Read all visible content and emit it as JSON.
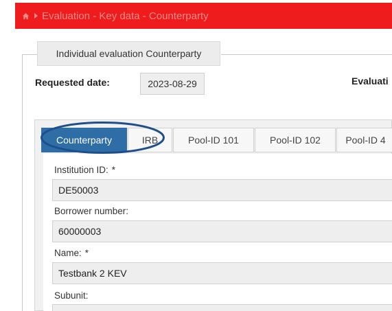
{
  "breadcrumb": {
    "home_icon": "home-icon",
    "separator_icon": "chevron-right-icon",
    "title": "Evaluation - Key data - Counterparty",
    "bar_color": "#ee1c1c"
  },
  "section": {
    "legend": "Individual evaluation Counterparty"
  },
  "requested_date": {
    "label": "Requested date:",
    "value": "2023-08-29"
  },
  "evaluation": {
    "label": "Evaluati"
  },
  "tabs": [
    {
      "label": "Counterparty",
      "active": true
    },
    {
      "label": "IRB",
      "active": false
    },
    {
      "label": "Pool-ID 101",
      "active": false
    },
    {
      "label": "Pool-ID 102",
      "active": false
    },
    {
      "label": "Pool-ID 4",
      "active": false
    }
  ],
  "fields": {
    "institution_id": {
      "label": "Institution ID:",
      "required_mark": "*",
      "value": "DE50003"
    },
    "borrower_number": {
      "label": "Borrower number:",
      "value": "60000003"
    },
    "name": {
      "label": "Name:",
      "required_mark": "*",
      "value": "Testbank 2 KEV"
    },
    "subunit": {
      "label": "Subunit:",
      "value": ""
    }
  },
  "colors": {
    "accent": "#2f6da7",
    "highlight_ellipse": "#1f4f8a"
  }
}
